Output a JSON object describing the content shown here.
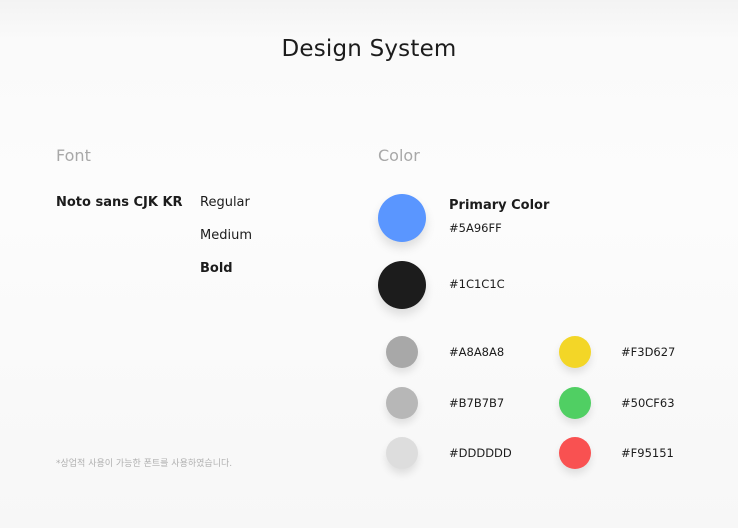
{
  "title": "Design System",
  "font": {
    "heading": "Font",
    "family": "Noto sans CJK KR",
    "weights": [
      "Regular",
      "Medium",
      "Bold"
    ],
    "note": "*상업적 사용이 가능한 폰트를 사용하였습니다."
  },
  "color": {
    "heading": "Color",
    "primary": {
      "name": "Primary Color",
      "hex": "#5A96FF"
    },
    "dark": {
      "hex": "#1C1C1C"
    },
    "grays": [
      {
        "hex": "#A8A8A8"
      },
      {
        "hex": "#B7B7B7"
      },
      {
        "hex": "#DDDDDD"
      }
    ],
    "accents": [
      {
        "hex": "#F3D627"
      },
      {
        "hex": "#50CF63"
      },
      {
        "hex": "#F95151"
      }
    ]
  }
}
